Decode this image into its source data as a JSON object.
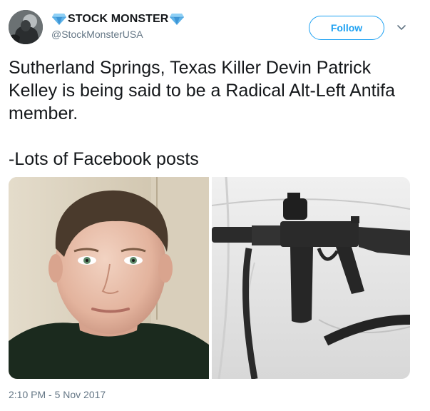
{
  "author": {
    "display_name": "STOCK MONSTER",
    "handle": "@StockMonsterUSA",
    "avatar_icon": "avatar-profile-photo",
    "badge_icon": "blue-diamond-emoji"
  },
  "actions": {
    "follow_label": "Follow",
    "more_icon": "chevron-down-icon"
  },
  "tweet": {
    "text_line_1": "Sutherland Springs, Texas Killer Devin Patrick Kelley is being said to be a Radical Alt-Left Antifa member.",
    "text_line_2": "-Lots of Facebook posts",
    "media": [
      {
        "description_icon": "photo-man-portrait"
      },
      {
        "description_icon": "photo-rifle-on-chair"
      }
    ],
    "timestamp": "2:10 PM - 5 Nov 2017"
  },
  "colors": {
    "accent": "#1da1f2",
    "text": "#14171a",
    "secondary_text": "#657786",
    "diamond": "#4aa3df"
  }
}
